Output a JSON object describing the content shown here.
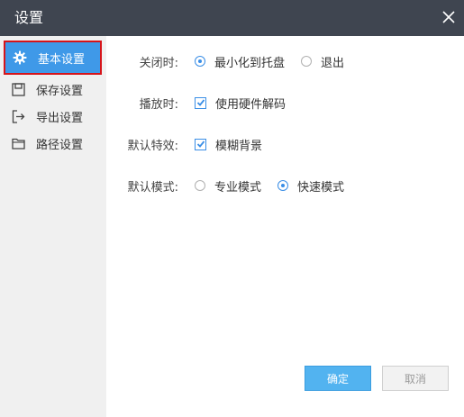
{
  "window": {
    "title": "设置",
    "close_icon": "close-icon"
  },
  "sidebar": {
    "items": [
      {
        "label": "基本设置",
        "icon": "gear-icon",
        "active": true
      },
      {
        "label": "保存设置",
        "icon": "save-icon",
        "active": false
      },
      {
        "label": "导出设置",
        "icon": "export-icon",
        "active": false
      },
      {
        "label": "路径设置",
        "icon": "folder-icon",
        "active": false
      }
    ]
  },
  "settings": {
    "close_behavior": {
      "label": "关闭时:",
      "options": [
        "最小化到托盘",
        "退出"
      ],
      "selected": "最小化到托盘"
    },
    "playback": {
      "label": "播放时:",
      "option": "使用硬件解码",
      "checked": true
    },
    "default_effect": {
      "label": "默认特效:",
      "option": "模糊背景",
      "checked": true
    },
    "default_mode": {
      "label": "默认模式:",
      "options": [
        "专业模式",
        "快速模式"
      ],
      "selected": "快速模式"
    }
  },
  "buttons": {
    "ok": "确定",
    "cancel": "取消"
  },
  "colors": {
    "titlebar": "#3f4550",
    "accent": "#3f99e8",
    "sidebar_bg": "#f0f0f0",
    "highlight_border": "#d6141a"
  }
}
